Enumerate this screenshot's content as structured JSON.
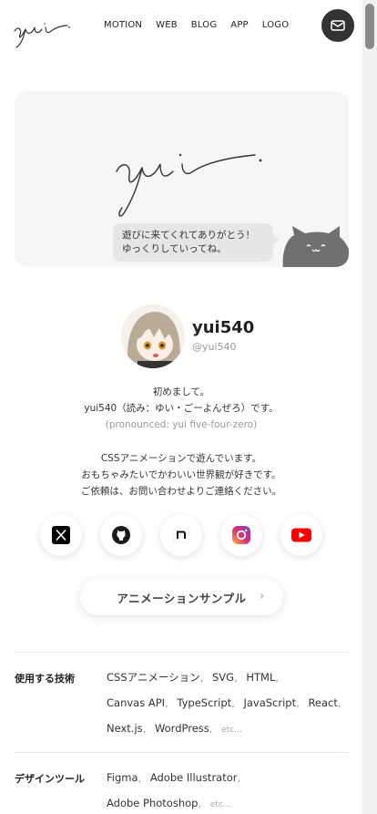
{
  "header": {
    "nav": [
      "MOTION",
      "WEB",
      "BLOG",
      "APP",
      "LOGO"
    ]
  },
  "hero": {
    "bubble_line1": "遊びに来てくれてありがとう！",
    "bubble_line2": "ゆっくりしていってね。"
  },
  "profile": {
    "name": "yui540",
    "handle": "@yui540",
    "greeting": "初めまして。",
    "reading": "yui540（読み：ゆい・ごーよんぜろ）です。",
    "pronounced": "(pronounced: yui five-four-zero)",
    "desc1": "CSSアニメーションで遊んでいます。",
    "desc2": "おもちゃみたいでかわいい世界観が好きです。",
    "desc3": "ご依頼は、お問い合わせよりご連絡ください。"
  },
  "socials": [
    "x-icon",
    "github-icon",
    "note-icon",
    "instagram-icon",
    "youtube-icon"
  ],
  "cta": {
    "label": "アニメーションサンプル"
  },
  "tech": {
    "label": "使用する技術",
    "line1": [
      "CSSアニメーション",
      "SVG",
      "HTML"
    ],
    "line2": [
      "Canvas API",
      "TypeScript",
      "JavaScript",
      "React"
    ],
    "line3": [
      "Next.js",
      "WordPress"
    ],
    "etc": "etc..."
  },
  "design": {
    "label": "デザインツール",
    "line1": [
      "Figma",
      "Adobe Illustrator"
    ],
    "line2": [
      "Adobe Photoshop"
    ],
    "etc": "etc..."
  }
}
